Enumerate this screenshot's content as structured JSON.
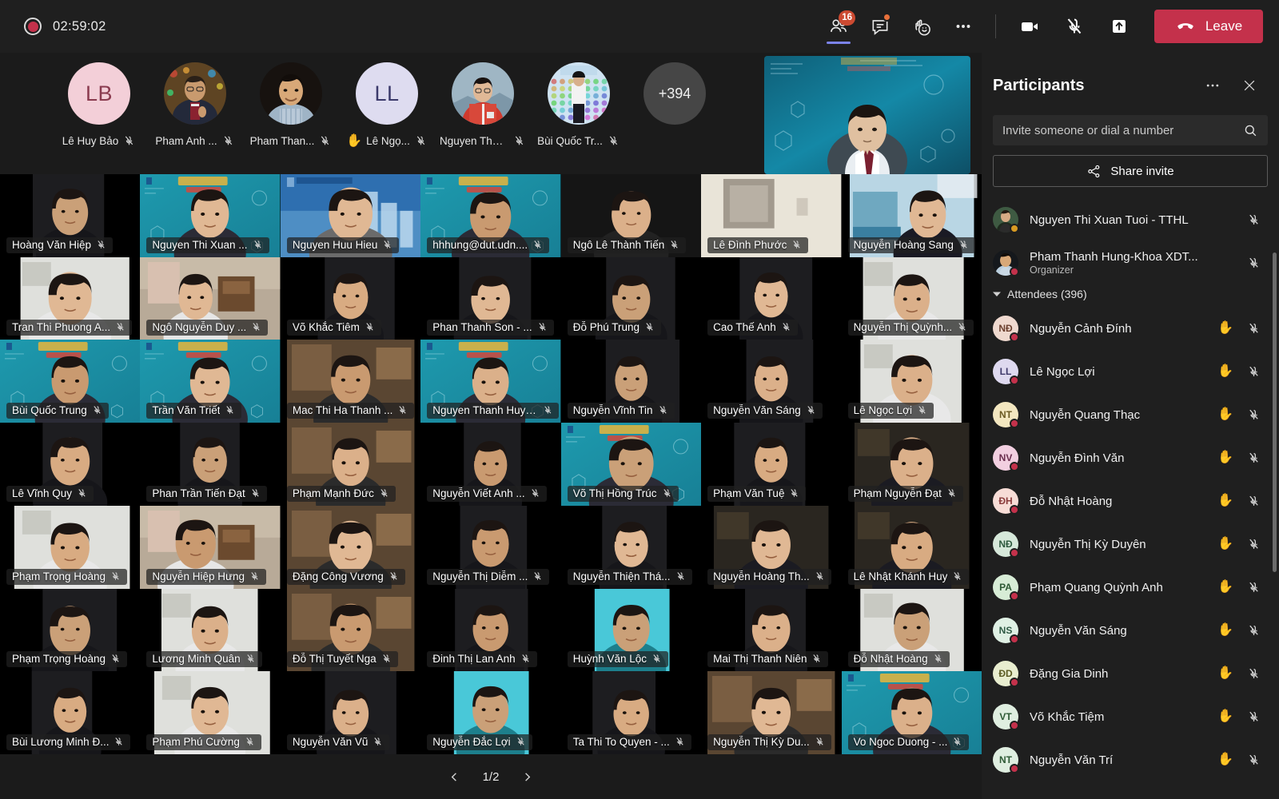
{
  "topbar": {
    "recording_time": "02:59:02",
    "participants_badge": "16",
    "leave_label": "Leave",
    "icons": {
      "record": "record-icon",
      "people": "people-icon",
      "chat": "chat-icon",
      "reactions": "reactions-icon",
      "more": "more-icon",
      "camera": "camera-icon",
      "mic_muted": "mic-muted-icon",
      "share": "share-screen-icon",
      "hangup": "hangup-icon"
    }
  },
  "filmstrip": {
    "people": [
      {
        "name": "Lê Huy Bảo",
        "initials": "LB",
        "bg": "#f3cfd8",
        "fg": "#8a3b4f",
        "photo": null,
        "muted": true,
        "hand": false
      },
      {
        "name": "Pham Anh ...",
        "initials": "PA",
        "bg": "#6b4f2a",
        "fg": "#ffffff",
        "photo": "man-suit",
        "muted": true,
        "hand": false
      },
      {
        "name": "Pham Than...",
        "initials": "PT",
        "bg": "#2a2320",
        "fg": "#ffffff",
        "photo": "man-smile",
        "muted": true,
        "hand": false
      },
      {
        "name": "Lê Ngọ...",
        "initials": "LL",
        "bg": "#dedcf0",
        "fg": "#3b3a6b",
        "photo": null,
        "muted": true,
        "hand": true
      },
      {
        "name": "Nguyen Thanh ...",
        "initials": "NT",
        "bg": "#9ab4c4",
        "fg": "#ffffff",
        "photo": "woman-red",
        "muted": true,
        "hand": false
      },
      {
        "name": "Bùi Quốc Tr...",
        "initials": "BT",
        "bg": "#cfe0ee",
        "fg": "#2a4458",
        "photo": "poster-man",
        "muted": true,
        "hand": false
      }
    ],
    "overflow_label": "+394"
  },
  "grid": {
    "page_label": "1/2",
    "tiles": [
      {
        "name": "Hoàng Văn Hiệp",
        "muted": true,
        "style": "dark-portrait"
      },
      {
        "name": "Nguyen Thi Xuan ...",
        "muted": true,
        "style": "teal-bg"
      },
      {
        "name": "Nguyen Huu Hieu",
        "muted": true,
        "style": "blue-campus"
      },
      {
        "name": "hhhung@dut.udn....",
        "muted": true,
        "style": "teal-bg"
      },
      {
        "name": "Ngô Lê Thành Tiến",
        "muted": true,
        "style": "room"
      },
      {
        "name": "Lê Đình Phước",
        "muted": true,
        "style": "bright-room"
      },
      {
        "name": "Nguyễn Hoàng Sang",
        "muted": true,
        "style": "blue-room"
      },
      {
        "name": "Tran Thi Phuong A...",
        "muted": true,
        "style": "light-room"
      },
      {
        "name": "Ngô Nguyễn Duy ...",
        "muted": true,
        "style": "home"
      },
      {
        "name": "Võ Khắc Tiêm",
        "muted": true,
        "style": "dark-portrait"
      },
      {
        "name": "Phan Thanh Son - ...",
        "muted": true,
        "style": "dark-portrait"
      },
      {
        "name": "Đỗ Phú Trung",
        "muted": true,
        "style": "dark-portrait"
      },
      {
        "name": "Cao Thế Anh",
        "muted": true,
        "style": "dark-portrait"
      },
      {
        "name": "Nguyễn Thị Quỳnh...",
        "muted": true,
        "style": "light-room"
      },
      {
        "name": "Bùi Quốc Trung",
        "muted": true,
        "style": "teal-bg"
      },
      {
        "name": "Trần Văn Triết",
        "muted": true,
        "style": "teal-bg"
      },
      {
        "name": "Mac Thi Ha Thanh ...",
        "muted": true,
        "style": "warm-room"
      },
      {
        "name": "Nguyen Thanh Huye...",
        "muted": true,
        "style": "teal-bg"
      },
      {
        "name": "Nguyễn Vĩnh Tin",
        "muted": true,
        "style": "dark-portrait"
      },
      {
        "name": "Nguyễn Văn Sáng",
        "muted": true,
        "style": "dark-portrait"
      },
      {
        "name": "Lê Ngọc Lợi",
        "muted": true,
        "style": "light-room"
      },
      {
        "name": "Lê Vĩnh Quy",
        "muted": true,
        "style": "dark-portrait"
      },
      {
        "name": "Phan Trần Tiến Đạt",
        "muted": true,
        "style": "dark-portrait"
      },
      {
        "name": "Phạm Mạnh Đức",
        "muted": true,
        "style": "warm-room"
      },
      {
        "name": "Nguyễn Viết Anh ...",
        "muted": true,
        "style": "dark-portrait"
      },
      {
        "name": "Võ Thị Hồng Trúc",
        "muted": true,
        "style": "teal-bg"
      },
      {
        "name": "Phạm Văn Tuệ",
        "muted": true,
        "style": "dark-portrait"
      },
      {
        "name": "Phạm Nguyễn Đạt",
        "muted": true,
        "style": "dark-room"
      },
      {
        "name": "Phạm Trọng Hoàng",
        "muted": true,
        "style": "light-room"
      },
      {
        "name": "Nguyễn Hiệp Hưng",
        "muted": true,
        "style": "home"
      },
      {
        "name": "Đặng Công Vương",
        "muted": true,
        "style": "warm-room"
      },
      {
        "name": "Nguyễn Thị Diễm ...",
        "muted": true,
        "style": "dark-portrait"
      },
      {
        "name": "Nguyễn Thiện Thá...",
        "muted": true,
        "style": "dark-portrait"
      },
      {
        "name": "Nguyễn Hoàng Th...",
        "muted": true,
        "style": "dark-room"
      },
      {
        "name": "Lê Nhật Khánh Huy",
        "muted": true,
        "style": "dark-room"
      },
      {
        "name": "Phạm Trọng Hoàng",
        "muted": true,
        "style": "dark-portrait"
      },
      {
        "name": "Lương Minh Quân",
        "muted": true,
        "style": "light-room"
      },
      {
        "name": "Đỗ Thị Tuyết Nga",
        "muted": true,
        "style": "warm-room"
      },
      {
        "name": "Đinh Thị Lan Anh",
        "muted": true,
        "style": "dark-portrait"
      },
      {
        "name": "Huỳnh Văn Lộc",
        "muted": true,
        "style": "cyan-room"
      },
      {
        "name": "Mai Thị Thanh Niên",
        "muted": true,
        "style": "dark-portrait"
      },
      {
        "name": "Đỗ Nhật Hoàng",
        "muted": true,
        "style": "light-room"
      },
      {
        "name": "Bùi Lương Minh Đ...",
        "muted": true,
        "style": "dark-portrait"
      },
      {
        "name": "Phạm Phú Cường",
        "muted": true,
        "style": "light-room"
      },
      {
        "name": "Nguyễn Văn Vũ",
        "muted": true,
        "style": "dark-portrait"
      },
      {
        "name": "Nguyễn Đắc Lợi",
        "muted": true,
        "style": "cyan-room"
      },
      {
        "name": "Ta Thi To Quyen - ...",
        "muted": true,
        "style": "dark-portrait"
      },
      {
        "name": "Nguyễn Thị Kỳ Du...",
        "muted": true,
        "style": "warm-room"
      },
      {
        "name": "Vo Ngoc Duong - ...",
        "muted": true,
        "style": "teal-bg"
      }
    ]
  },
  "panel": {
    "title": "Participants",
    "more_label": "more-options",
    "close_label": "close",
    "search_placeholder": "Invite someone or dial a number",
    "share_invite_label": "Share invite",
    "pinned": [
      {
        "name": "Nguyen Thi Xuan Tuoi - TTHL",
        "initials": "NT",
        "bg": "#4a6a50",
        "fg": "#ffffff",
        "photo": true,
        "role": null,
        "presence": "#d89b23",
        "hand": false,
        "muted": true
      },
      {
        "name": "Pham Thanh Hung-Khoa XDT...",
        "initials": "PH",
        "bg": "#2f3b4a",
        "fg": "#ffffff",
        "photo": true,
        "role": "Organizer",
        "presence": "#c4314b",
        "hand": false,
        "muted": true
      }
    ],
    "section_label": "Attendees (396)",
    "attendees": [
      {
        "name": "Nguyễn Cảnh Đính",
        "initials": "NĐ",
        "bg": "#efd9cf",
        "fg": "#6b3f2e",
        "presence": "#c4314b",
        "hand": true,
        "muted": true
      },
      {
        "name": "Lê Ngọc Lợi",
        "initials": "LL",
        "bg": "#ded9ef",
        "fg": "#3f3a6b",
        "presence": "#c4314b",
        "hand": true,
        "muted": true
      },
      {
        "name": "Nguyễn Quang Thạc",
        "initials": "NT",
        "bg": "#f3e7c0",
        "fg": "#6b5a22",
        "presence": "#c4314b",
        "hand": true,
        "muted": true
      },
      {
        "name": "Nguyễn Đình Văn",
        "initials": "NV",
        "bg": "#f2cfe0",
        "fg": "#6b2f4f",
        "presence": "#c4314b",
        "hand": true,
        "muted": true
      },
      {
        "name": "Đỗ Nhật Hoàng",
        "initials": "ĐH",
        "bg": "#f7dcd6",
        "fg": "#8a3b3b",
        "presence": "#c4314b",
        "hand": true,
        "muted": true
      },
      {
        "name": "Nguyễn Thị Kỳ Duyên",
        "initials": "NĐ",
        "bg": "#d6e8da",
        "fg": "#2e5a3f",
        "presence": "#c4314b",
        "hand": true,
        "muted": true
      },
      {
        "name": "Phạm Quang Quỳnh Anh",
        "initials": "PA",
        "bg": "#d7ecd6",
        "fg": "#2e5a35",
        "presence": "#c4314b",
        "hand": true,
        "muted": true
      },
      {
        "name": "Nguyễn Văn Sáng",
        "initials": "NS",
        "bg": "#dff0e4",
        "fg": "#2f5a45",
        "presence": "#c4314b",
        "hand": true,
        "muted": true
      },
      {
        "name": "Đặng Gia Dinh",
        "initials": "ĐD",
        "bg": "#e8edcf",
        "fg": "#5a5a22",
        "presence": "#c4314b",
        "hand": true,
        "muted": true
      },
      {
        "name": "Võ Khắc Tiệm",
        "initials": "VT",
        "bg": "#dfeee0",
        "fg": "#2e5a35",
        "presence": "#c4314b",
        "hand": true,
        "muted": true
      },
      {
        "name": "Nguyễn Văn Trí",
        "initials": "NT",
        "bg": "#dfeee0",
        "fg": "#2e5a35",
        "presence": "#c4314b",
        "hand": true,
        "muted": true
      }
    ]
  }
}
